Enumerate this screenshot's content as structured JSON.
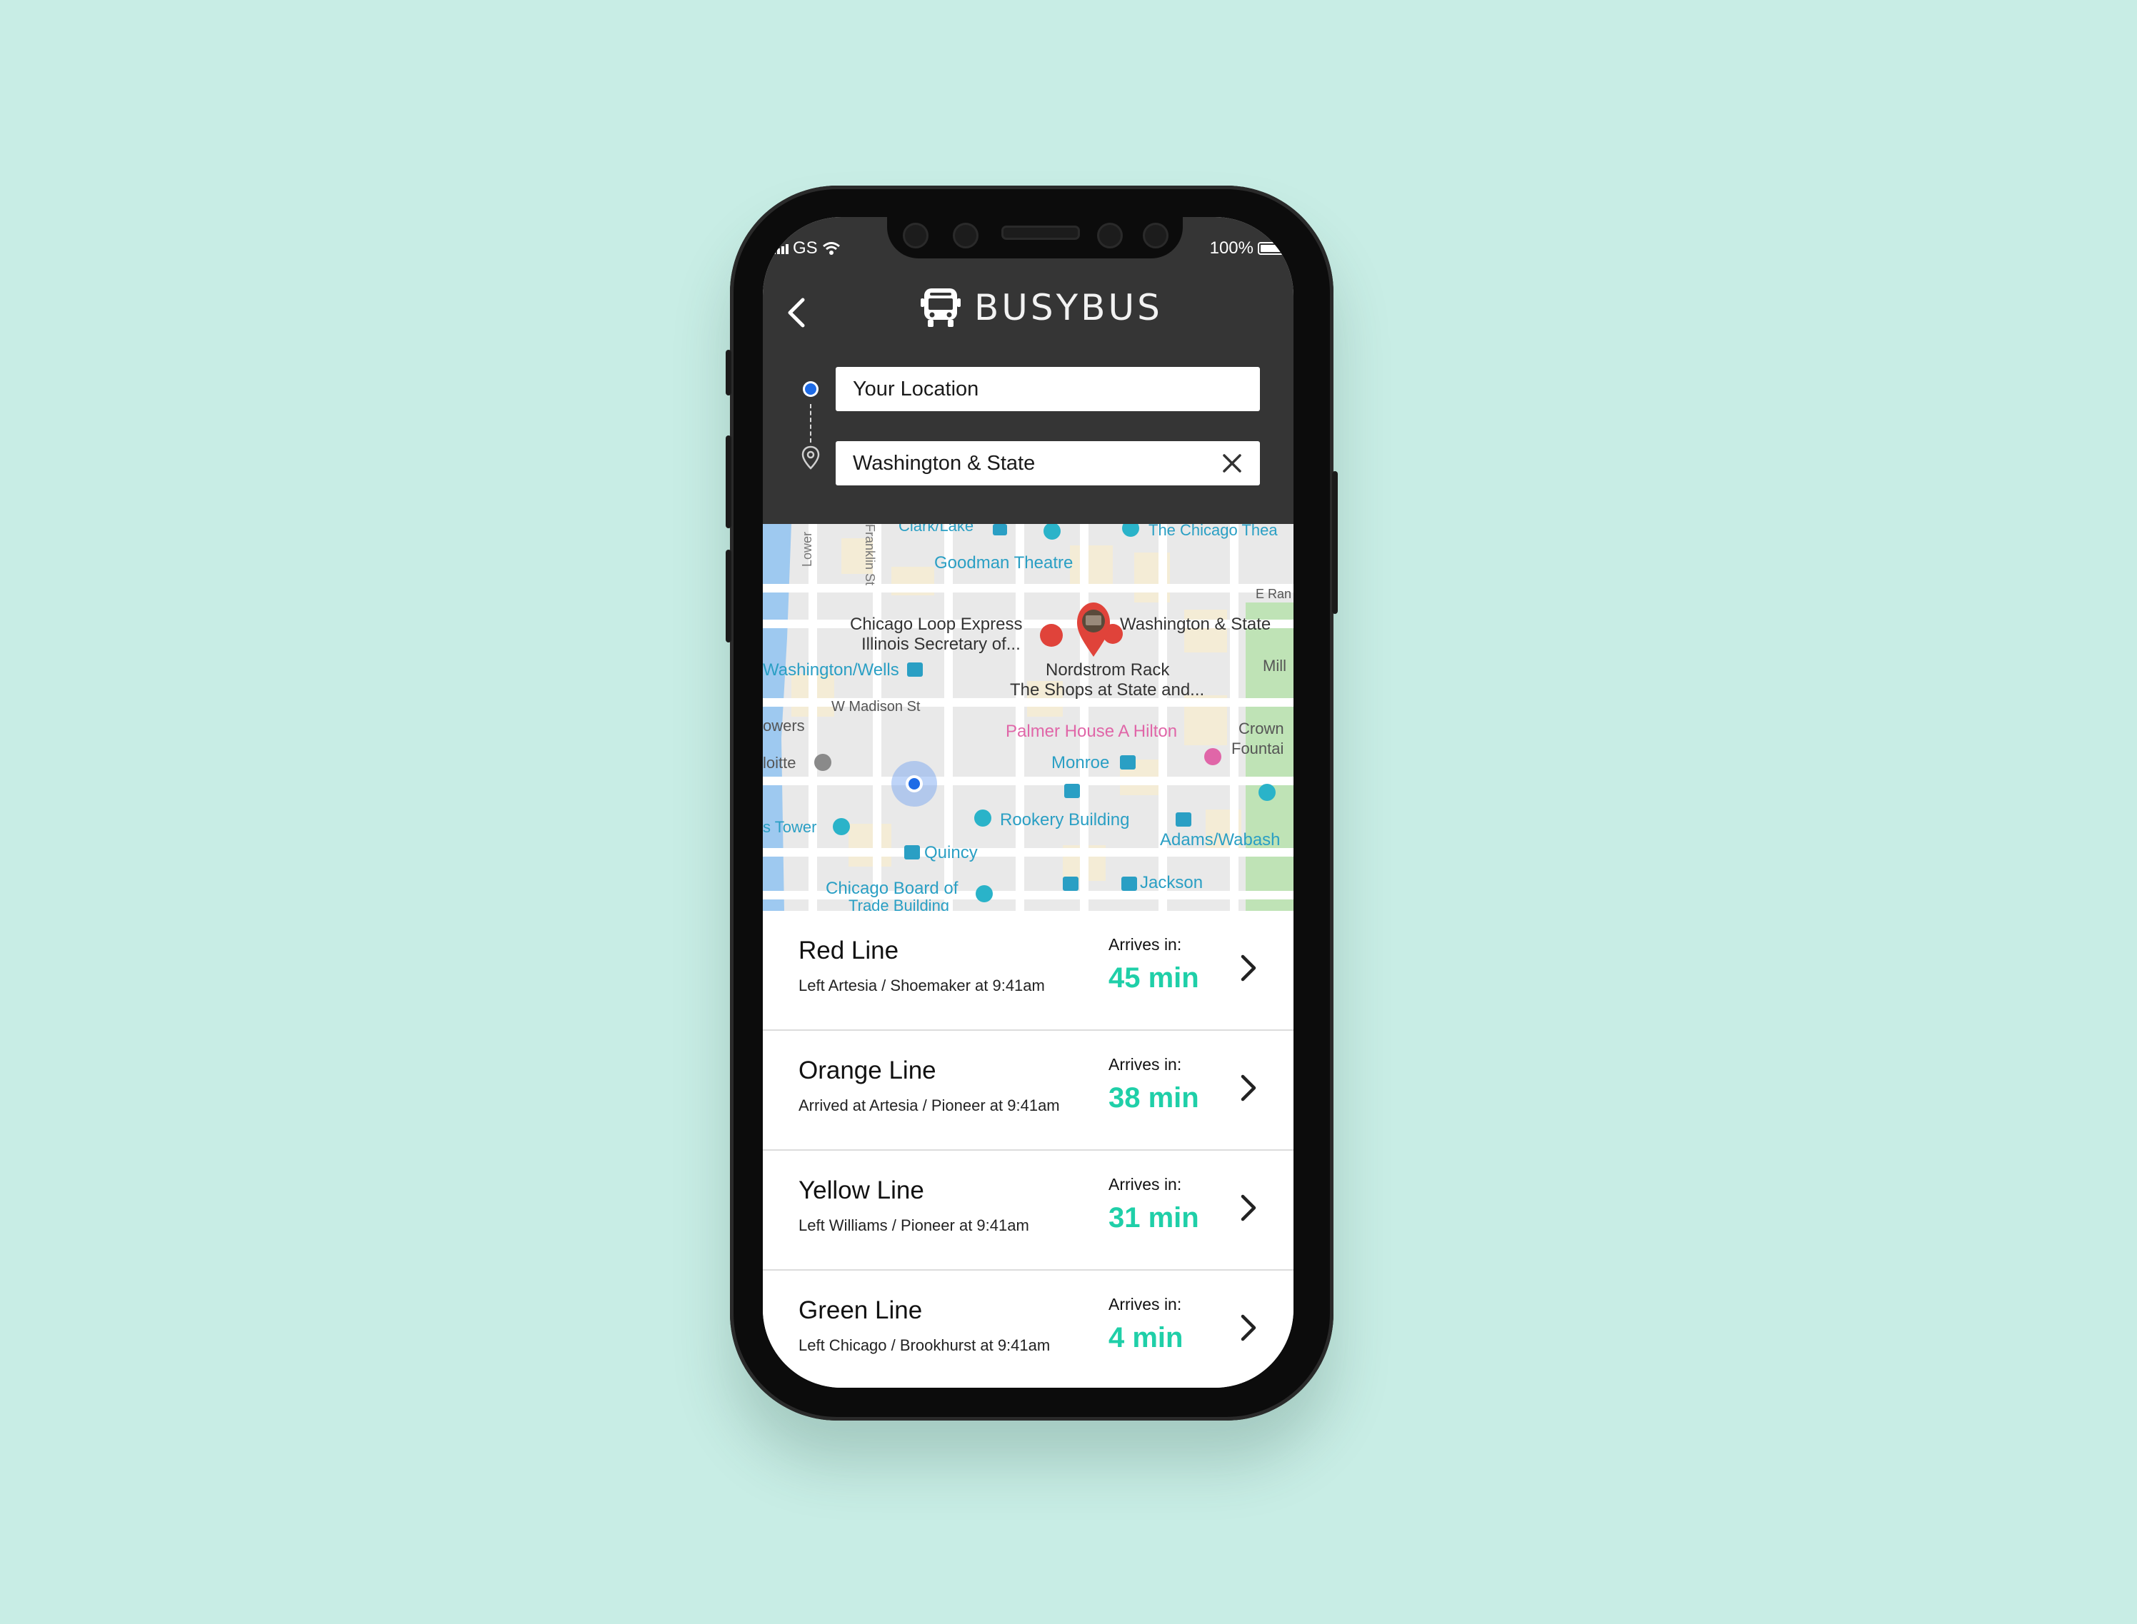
{
  "status_bar": {
    "carrier": "GS",
    "battery": "100%"
  },
  "header": {
    "app_name": "BUSYBUS"
  },
  "search": {
    "origin_value": "Your Location",
    "destination_value": "Washington & State"
  },
  "map": {
    "labels": {
      "clark_lake": "Clark/Lake",
      "chicago_theatre": "The Chicago Thea",
      "lower": "Lower",
      "franklin": "Franklin St",
      "goodman": "Goodman Theatre",
      "e_ran": "E Ran",
      "loop_express": "Chicago Loop Express",
      "illinois_sec": "Illinois Secretary of...",
      "wash_state": "Washington & State",
      "wash_wells": "Washington/Wells",
      "nordstrom": "Nordstrom Rack",
      "shops": "The Shops at State and...",
      "mill": "Mill",
      "madison": "W Madison St",
      "owers": "owers",
      "palmer": "Palmer House A Hilton",
      "crown": "Crown",
      "fountain": "Fountai",
      "deloitte": "loitte",
      "monroe": "Monroe",
      "s_tower": "s Tower",
      "rookery": "Rookery Building",
      "adams": "Adams/Wabash",
      "quincy": "Quincy",
      "cbot1": "Chicago Board of",
      "cbot2": "Trade Building",
      "jackson": "Jackson"
    }
  },
  "routes": [
    {
      "name": "Red Line",
      "status": "Left Artesia / Shoemaker at 9:41am",
      "arrives_label": "Arrives in:",
      "arrives_value": "45 min"
    },
    {
      "name": "Orange Line",
      "status": "Arrived at Artesia / Pioneer at 9:41am",
      "arrives_label": "Arrives in:",
      "arrives_value": "38 min"
    },
    {
      "name": "Yellow Line",
      "status": "Left Williams / Pioneer at 9:41am",
      "arrives_label": "Arrives in:",
      "arrives_value": "31 min"
    },
    {
      "name": "Green Line",
      "status": "Left Chicago / Brookhurst at 9:41am",
      "arrives_label": "Arrives in:",
      "arrives_value": "4 min"
    }
  ],
  "icons": [
    "back-arrow-icon",
    "bus-icon",
    "clear-icon",
    "origin-dot-icon",
    "destination-pin-icon",
    "chevron-right-icon",
    "wifi-icon",
    "signal-icon",
    "battery-icon",
    "current-location-icon",
    "map-pin-icon"
  ],
  "colors": {
    "background": "#c8ede5",
    "header": "#353535",
    "accent": "#1fcfa8",
    "origin_dot": "#1e6be6",
    "pin_red": "#e0433a"
  }
}
